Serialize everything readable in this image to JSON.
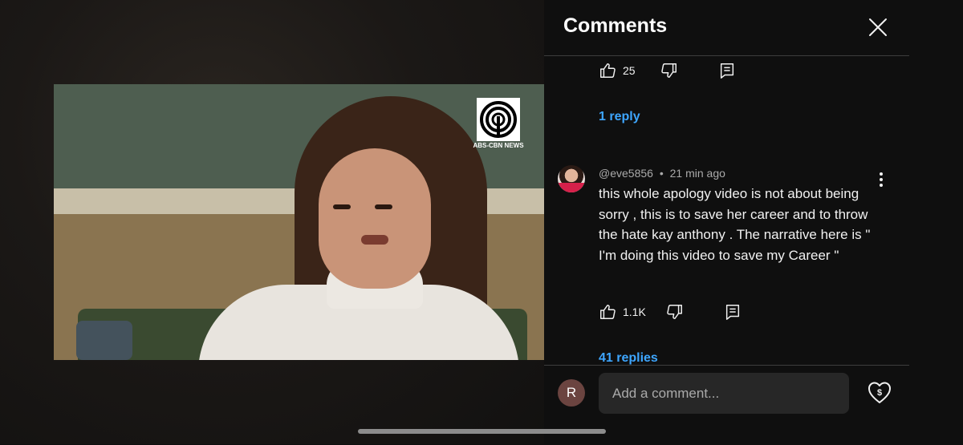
{
  "panel": {
    "title": "Comments"
  },
  "video": {
    "logo_text": "ABS-CBN NEWS"
  },
  "previous_comment": {
    "like_count": "25",
    "replies_label": "1 reply"
  },
  "comment": {
    "handle": "@eve5856",
    "separator": "•",
    "time": "21 min ago",
    "text": "this whole apology video is not about being sorry , this is to save her career and to throw the hate kay anthony . The narrative here is \" I'm doing this video to save my Career \"",
    "like_count": "1.1K",
    "replies_label": "41 replies"
  },
  "footer": {
    "user_initial": "R",
    "input_placeholder": "Add a comment..."
  },
  "colors": {
    "accent_link": "#3ea6ff",
    "background": "#0f0f0f",
    "input_bg": "#272727"
  },
  "icons": {
    "close": "close-icon",
    "like": "thumbs-up-icon",
    "dislike": "thumbs-down-icon",
    "reply": "reply-icon",
    "more": "kebab-menu-icon",
    "thanks": "super-thanks-heart-icon"
  }
}
